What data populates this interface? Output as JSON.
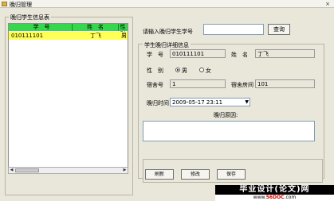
{
  "window": {
    "title": "晚归管理",
    "close_glyph": "×"
  },
  "left_panel": {
    "legend": "晚归学生信息表",
    "columns": [
      "学　号",
      "姓　名",
      "性别"
    ],
    "rows": [
      {
        "id": "010111101",
        "name": "丁飞",
        "gender": "男"
      }
    ]
  },
  "search": {
    "label": "请输入晚归学生学号",
    "value": "",
    "button": "查询"
  },
  "detail": {
    "legend": "学生晚归详细信息",
    "student_id_label": "学　号",
    "student_id": "010111101",
    "name_label": "姓　名",
    "name": "丁飞",
    "gender_label": "性　别",
    "gender_male": "男",
    "gender_female": "女",
    "building_label": "宿舍号",
    "building": "1",
    "room_label": "宿舍房间",
    "room": "101",
    "time_label": "晚归时间",
    "time": "2009-05-17 23:11",
    "reason_label": "晚归原因:",
    "reason": ""
  },
  "buttons": {
    "refresh": "刷新",
    "edit": "修改",
    "save": "保存"
  },
  "watermark": {
    "title": "毕业设计(论文)网",
    "url_prefix": "www.",
    "url_brand": "56DOC",
    "url_suffix": ".com",
    "logo": "56DOC"
  }
}
